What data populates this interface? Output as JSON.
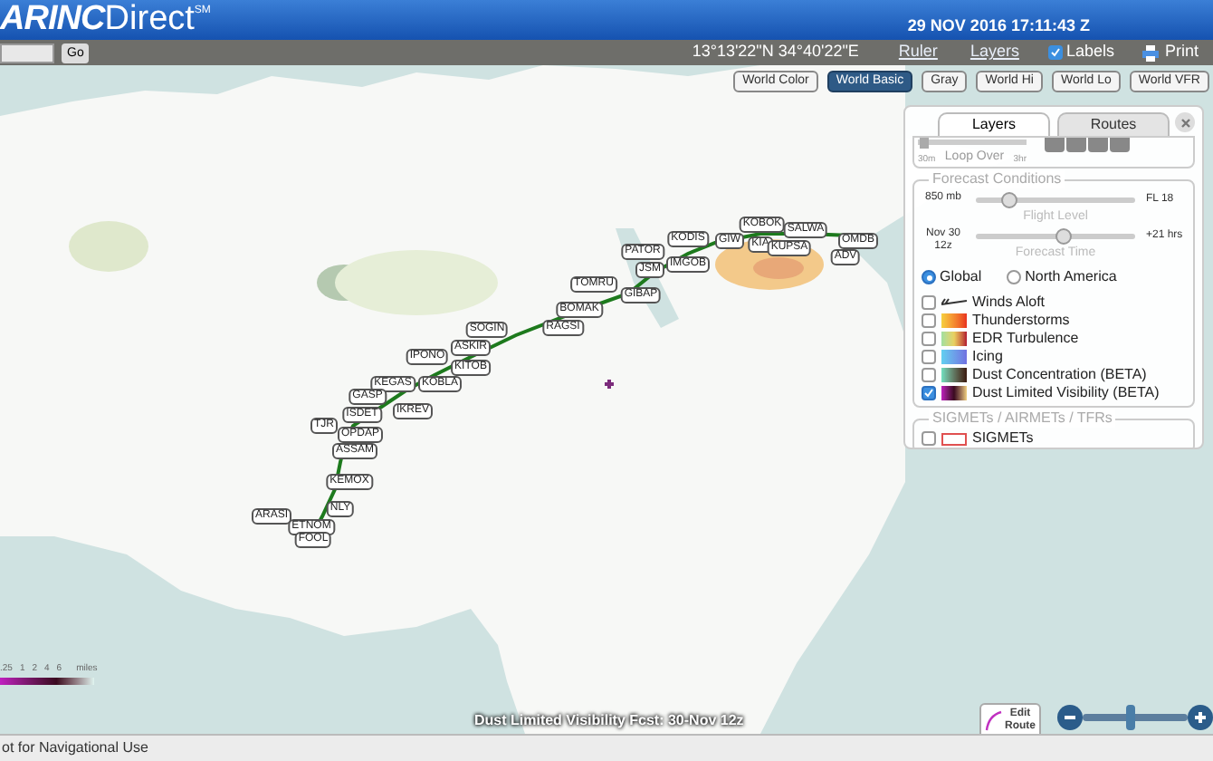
{
  "header": {
    "logo": "ARINC",
    "logo_suffix": "Direct",
    "logo_mark": "SM",
    "datetime": "29 NOV 2016 17:11:43 Z"
  },
  "toolbar": {
    "go_button": "Go",
    "coordinates": "13°13'22\"N 34°40'22\"E",
    "links": [
      "Ruler",
      "Layers"
    ],
    "labels_toggle": {
      "label": "Labels",
      "checked": true
    },
    "print": "Print"
  },
  "basemaps": [
    {
      "label": "World Color",
      "selected": false
    },
    {
      "label": "World Basic",
      "selected": true
    },
    {
      "label": "Gray",
      "selected": false
    },
    {
      "label": "World Hi",
      "selected": false
    },
    {
      "label": "World Lo",
      "selected": false
    },
    {
      "label": "World VFR",
      "selected": false
    }
  ],
  "route": {
    "waypoints": [
      "KOBOK",
      "SALWA",
      "KODIS",
      "GIW",
      "KIA",
      "KUPSA",
      "OMDB",
      "PATOR",
      "ADV",
      "IMGOB",
      "JSM",
      "TOMRU",
      "GIBAP",
      "BOMAK",
      "RAGSI",
      "SOGIN",
      "ASKIR",
      "IPONO",
      "KITOB",
      "KEGAS",
      "KOBLA",
      "GASP",
      "IKREV",
      "ISDET",
      "TJR",
      "OPDAP",
      "ASSAM",
      "KEMOX",
      "NLY",
      "ARASI",
      "ETNOM",
      "FOOL"
    ]
  },
  "layers_panel": {
    "tabs": [
      {
        "label": "Layers",
        "selected": true
      },
      {
        "label": "Routes",
        "selected": false
      }
    ],
    "loop": {
      "label": "Loop Over",
      "start": "30m",
      "end": "3hr",
      "level": 0.05
    },
    "forecast": {
      "title": "Forecast Conditions",
      "level_slider": {
        "left": "850 mb",
        "right": "FL 18",
        "caption": "Flight Level",
        "level": 0.2
      },
      "time_slider": {
        "left": "Nov 30",
        "left_2": "12z",
        "right": "+21 hrs",
        "caption": "Forecast Time",
        "level": 0.55
      },
      "regions": [
        {
          "label": "Global",
          "selected": true
        },
        {
          "label": "North America",
          "selected": false
        }
      ],
      "layers": [
        {
          "label": "Winds Aloft",
          "checked": false,
          "kind": "wind"
        },
        {
          "label": "Thunderstorms",
          "checked": false,
          "kind": "storm"
        },
        {
          "label": "EDR Turbulence",
          "checked": false,
          "kind": "turbulence"
        },
        {
          "label": "Icing",
          "checked": false,
          "kind": "icing"
        },
        {
          "label": "Dust Concentration (BETA)",
          "checked": false,
          "kind": "dust_concentration"
        },
        {
          "label": "Dust Limited Visibility (BETA)",
          "checked": true,
          "kind": "dust_visibility"
        }
      ]
    },
    "advisories": {
      "title": "SIGMETs / AIRMETs / TFRs",
      "items": [
        {
          "label": "SIGMETs",
          "checked": false
        }
      ]
    }
  },
  "legend": {
    "ticks": [
      ".25",
      "1",
      "2",
      "4",
      "6"
    ],
    "unit": "miles"
  },
  "caption": "Dust Limited Visibility Fcst: 30-Nov 12z",
  "edit_route": {
    "line_1": "Edit",
    "line_2": "Route"
  },
  "zoom": {
    "level": 0.45
  },
  "status_bar": "ot for Navigational Use"
}
